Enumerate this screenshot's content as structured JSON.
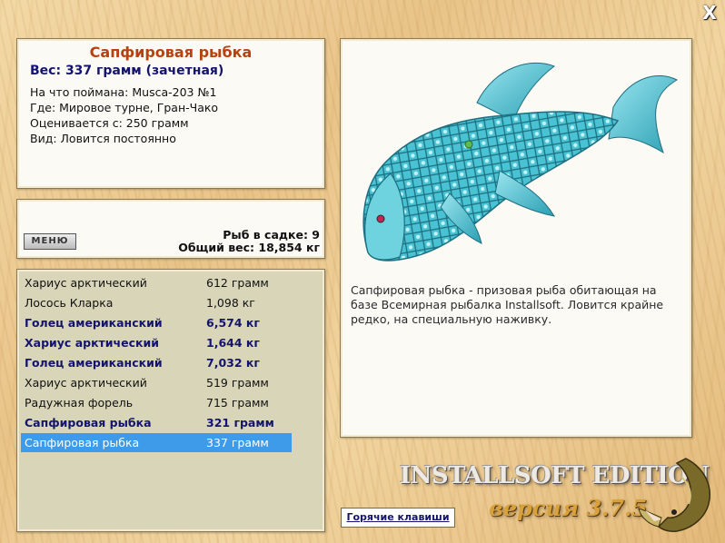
{
  "close_label": "X",
  "info": {
    "title": "Сапфировая рыбка",
    "weight": "Вес: 337 грамм (зачетная)",
    "lines": [
      "На что поймана: Musca-203 №1",
      "Где: Мировое турне, Гран-Чако",
      "Оценивается с: 250 грамм",
      "Вид: Ловится постоянно"
    ]
  },
  "basket": {
    "menu_label": "МЕНЮ",
    "count": "Рыб в садке: 9",
    "total": "Общий вес: 18,854 кг"
  },
  "catch_list": [
    {
      "name": "Хариус арктический",
      "weight": "612 грамм",
      "bold": false,
      "selected": false
    },
    {
      "name": "Лосось Кларка",
      "weight": "1,098 кг",
      "bold": false,
      "selected": false
    },
    {
      "name": "Голец американский",
      "weight": "6,574 кг",
      "bold": true,
      "selected": false
    },
    {
      "name": "Хариус арктический",
      "weight": "1,644 кг",
      "bold": true,
      "selected": false
    },
    {
      "name": "Голец американский",
      "weight": "7,032 кг",
      "bold": true,
      "selected": false
    },
    {
      "name": "Хариус арктический",
      "weight": "519 грамм",
      "bold": false,
      "selected": false
    },
    {
      "name": "Радужная форель",
      "weight": "715 грамм",
      "bold": false,
      "selected": false
    },
    {
      "name": "Сапфировая рыбка",
      "weight": "321 грамм",
      "bold": true,
      "selected": false
    },
    {
      "name": "Сапфировая рыбка",
      "weight": "337 грамм",
      "bold": false,
      "selected": true
    }
  ],
  "description": "Сапфировая рыбка - призовая рыба обитающая на базе Всемирная рыбалка Installsoft. Ловится крайне редко, на специальную наживку.",
  "logo": {
    "edition": "INSTALLSOFT EDITION",
    "version": "версия 3.7.5"
  },
  "hotkeys_label": "Горячие клавиши",
  "colors": {
    "title": "#b8410e",
    "bold_text": "#14146e",
    "selection": "#3d9be9",
    "fish": "#3fb7c9"
  }
}
